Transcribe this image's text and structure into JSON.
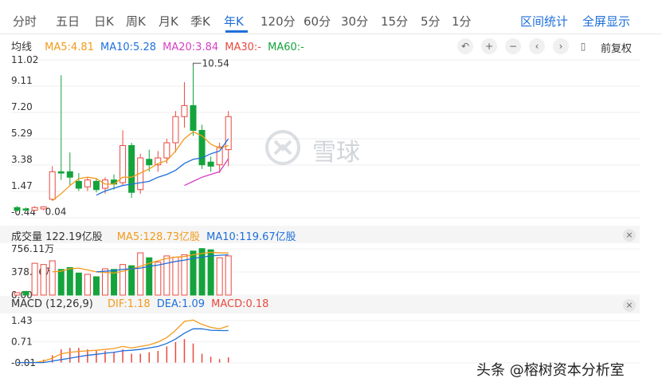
{
  "tabs": {
    "items": [
      "分时",
      "五日",
      "日K",
      "周K",
      "月K",
      "季K",
      "年K",
      "120分",
      "60分",
      "30分",
      "15分",
      "5分",
      "1分"
    ],
    "active": "年K",
    "interval_stats": "区间统计",
    "fullscreen": "全屏显示"
  },
  "price_panel": {
    "label": "均线",
    "ma5": "MA5:4.81",
    "ma10": "MA10:5.28",
    "ma20": "MA20:3.84",
    "ma30": "MA30:-",
    "ma60": "MA60:-",
    "restore_label": "前复权",
    "y_ticks": [
      "11.02",
      "9.11",
      "7.20",
      "5.29",
      "3.38",
      "1.47",
      "-0.44"
    ],
    "low_annotation": "0.04",
    "high_annotation": "10.54"
  },
  "volume_panel": {
    "label": "成交量 122.19亿股",
    "ma5": "MA5:128.73亿股",
    "ma10": "MA10:119.67亿股",
    "y_ticks": [
      "756.11万",
      "378.06万",
      "0.00"
    ]
  },
  "macd_panel": {
    "label": "MACD (12,26,9)",
    "dif": "DIF:1.18",
    "dea": "DEA:1.09",
    "macd": "MACD:0.18",
    "y_ticks": [
      "1.43",
      "0.71",
      "-0.01"
    ]
  },
  "watermark": "雪球",
  "credit": "头条 @榕树资本分析室",
  "colors": {
    "up": "#e8493f",
    "down": "#14a33c",
    "ma5": "#f29b1c",
    "ma10": "#1e6fd9",
    "ma20": "#d63fc4",
    "ma30": "#e8493f",
    "ma60": "#14a33c",
    "accent": "#1e6fd9"
  },
  "chart_data": {
    "type": "candlestick",
    "y_range": [
      -0.44,
      11.02
    ],
    "candles": [
      {
        "o": 0.3,
        "c": 0.1,
        "h": 0.4,
        "l": 0.0
      },
      {
        "o": 0.2,
        "c": 0.15,
        "h": 0.3,
        "l": 0.05
      },
      {
        "o": 0.1,
        "c": 0.3,
        "h": 0.4,
        "l": 0.04
      },
      {
        "o": 0.2,
        "c": 0.35,
        "h": 0.4,
        "l": 0.1
      },
      {
        "o": 0.9,
        "c": 2.9,
        "h": 3.3,
        "l": 0.8
      },
      {
        "o": 2.9,
        "c": 2.8,
        "h": 9.9,
        "l": 2.3
      },
      {
        "o": 2.9,
        "c": 2.5,
        "h": 4.3,
        "l": 1.9
      },
      {
        "o": 2.2,
        "c": 1.7,
        "h": 2.8,
        "l": 1.5
      },
      {
        "o": 1.8,
        "c": 2.3,
        "h": 2.5,
        "l": 1.5
      },
      {
        "o": 2.2,
        "c": 1.6,
        "h": 2.4,
        "l": 1.4
      },
      {
        "o": 1.7,
        "c": 2.3,
        "h": 2.5,
        "l": 1.3
      },
      {
        "o": 2.3,
        "c": 2.0,
        "h": 2.7,
        "l": 1.6
      },
      {
        "o": 2.1,
        "c": 4.8,
        "h": 5.9,
        "l": 1.9
      },
      {
        "o": 4.8,
        "c": 1.4,
        "h": 5.0,
        "l": 1.0
      },
      {
        "o": 1.6,
        "c": 3.9,
        "h": 4.2,
        "l": 1.3
      },
      {
        "o": 3.8,
        "c": 3.4,
        "h": 4.5,
        "l": 2.9
      },
      {
        "o": 3.4,
        "c": 3.9,
        "h": 4.4,
        "l": 2.9
      },
      {
        "o": 3.9,
        "c": 5.0,
        "h": 5.3,
        "l": 3.5
      },
      {
        "o": 5.0,
        "c": 6.9,
        "h": 7.3,
        "l": 4.3
      },
      {
        "o": 6.9,
        "c": 7.7,
        "h": 9.4,
        "l": 6.1
      },
      {
        "o": 7.7,
        "c": 5.9,
        "h": 10.54,
        "l": 5.5
      },
      {
        "o": 5.9,
        "c": 3.4,
        "h": 6.3,
        "l": 3.1
      },
      {
        "o": 3.6,
        "c": 3.3,
        "h": 4.0,
        "l": 2.9
      },
      {
        "o": 3.4,
        "c": 4.7,
        "h": 5.0,
        "l": 2.8
      },
      {
        "o": 4.5,
        "c": 6.9,
        "h": 7.3,
        "l": 3.3
      }
    ],
    "ma5": [
      null,
      null,
      null,
      null,
      0.8,
      1.3,
      1.9,
      2.4,
      2.5,
      2.4,
      2.0,
      2.0,
      2.5,
      2.5,
      2.8,
      3.1,
      3.5,
      3.7,
      4.4,
      5.3,
      5.8,
      5.5,
      4.9,
      4.6,
      4.8
    ],
    "ma10": [
      null,
      null,
      null,
      null,
      null,
      null,
      null,
      null,
      null,
      1.2,
      1.5,
      1.7,
      1.9,
      2.0,
      2.1,
      2.2,
      2.5,
      2.7,
      3.0,
      3.5,
      3.8,
      3.9,
      4.2,
      4.4,
      5.3
    ],
    "ma20": [
      null,
      null,
      null,
      null,
      null,
      null,
      null,
      null,
      null,
      null,
      null,
      null,
      null,
      null,
      null,
      null,
      null,
      null,
      null,
      1.9,
      2.2,
      2.5,
      2.7,
      2.9,
      3.84
    ],
    "volume_range": [
      0,
      756.11
    ],
    "volume": [
      40,
      60,
      520,
      500,
      560,
      420,
      450,
      360,
      340,
      300,
      430,
      420,
      500,
      480,
      690,
      610,
      540,
      640,
      620,
      660,
      720,
      760,
      740,
      610,
      640
    ],
    "volume_up": [
      true,
      false,
      true,
      true,
      true,
      false,
      false,
      false,
      true,
      false,
      true,
      false,
      true,
      false,
      true,
      false,
      true,
      true,
      true,
      true,
      false,
      false,
      false,
      true,
      true
    ],
    "volume_ma5": [
      null,
      null,
      null,
      null,
      380,
      390,
      430,
      440,
      410,
      380,
      370,
      360,
      390,
      430,
      470,
      520,
      560,
      600,
      620,
      630,
      660,
      680,
      700,
      690,
      690
    ],
    "volume_ma10": [
      null,
      null,
      null,
      null,
      null,
      null,
      null,
      null,
      null,
      380,
      390,
      400,
      420,
      430,
      440,
      470,
      490,
      520,
      550,
      570,
      600,
      620,
      640,
      650,
      660
    ],
    "macd_range": [
      -0.01,
      1.43
    ],
    "dif": [
      0,
      0,
      0,
      0.05,
      0.15,
      0.3,
      0.35,
      0.38,
      0.4,
      0.42,
      0.45,
      0.48,
      0.55,
      0.5,
      0.55,
      0.6,
      0.7,
      0.85,
      1.1,
      1.4,
      1.45,
      1.3,
      1.2,
      1.15,
      1.25
    ],
    "dea": [
      0,
      0,
      0,
      0,
      0.05,
      0.1,
      0.15,
      0.2,
      0.25,
      0.28,
      0.32,
      0.35,
      0.4,
      0.42,
      0.45,
      0.5,
      0.55,
      0.65,
      0.8,
      1.0,
      1.15,
      1.15,
      1.1,
      1.09,
      1.09
    ],
    "macd": [
      0,
      0,
      0,
      0.1,
      0.25,
      0.45,
      0.5,
      0.5,
      0.45,
      0.4,
      0.4,
      0.35,
      0.45,
      0.3,
      0.3,
      0.35,
      0.4,
      0.55,
      0.7,
      0.8,
      0.65,
      0.3,
      0.2,
      0.12,
      0.18
    ]
  }
}
